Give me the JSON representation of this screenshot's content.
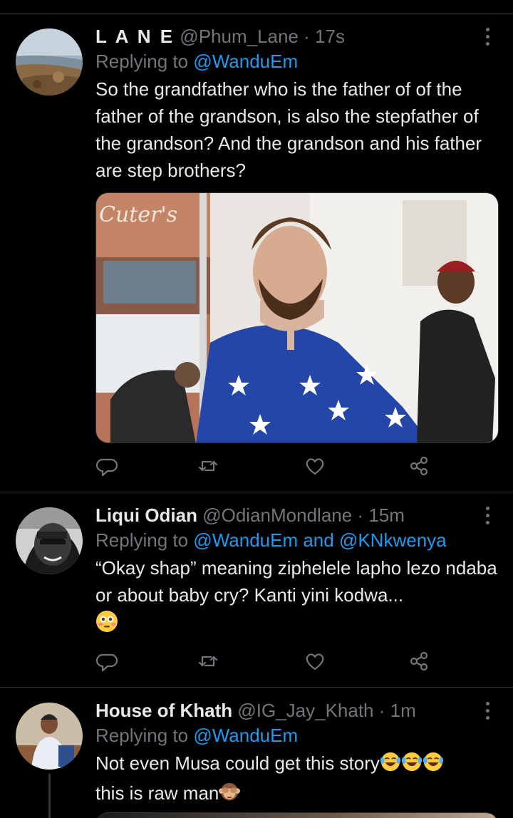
{
  "tweets": [
    {
      "name": "L A N E",
      "handle": "@Phum_Lane",
      "time": "17s",
      "replying_prefix": "Replying to ",
      "mentions": "@WanduEm",
      "text": "So the grandfather who is the father of of the father of the grandson, is also the stepfather of the grandson? And the grandson and his father are step brothers?",
      "media_text": "Cuter's"
    },
    {
      "name": "Liqui Odian",
      "handle": "@OdianMondlane",
      "time": "15m",
      "replying_prefix": "Replying to ",
      "mentions": "@WanduEm and @KNkwenya",
      "text": "“Okay shap” meaning ziphelele lapho lezo ndaba or about baby cry? Kanti yini kodwa..."
    },
    {
      "name": "House of Khath",
      "handle": "@IG_Jay_Khath",
      "time": "1m",
      "replying_prefix": "Replying to ",
      "mentions": "@WanduEm",
      "text_line1": "Not even Musa could get this story",
      "text_line2": "this is raw man"
    }
  ],
  "separator": " · ",
  "icons": {
    "reply": "reply-icon",
    "retweet": "retweet-icon",
    "like": "heart-icon",
    "share": "share-icon",
    "more": "more-options-icon"
  },
  "colors": {
    "background": "#000000",
    "text": "#e7e9ea",
    "secondary": "#71767b",
    "link": "#1d9bf0",
    "divider": "#2f3336"
  }
}
